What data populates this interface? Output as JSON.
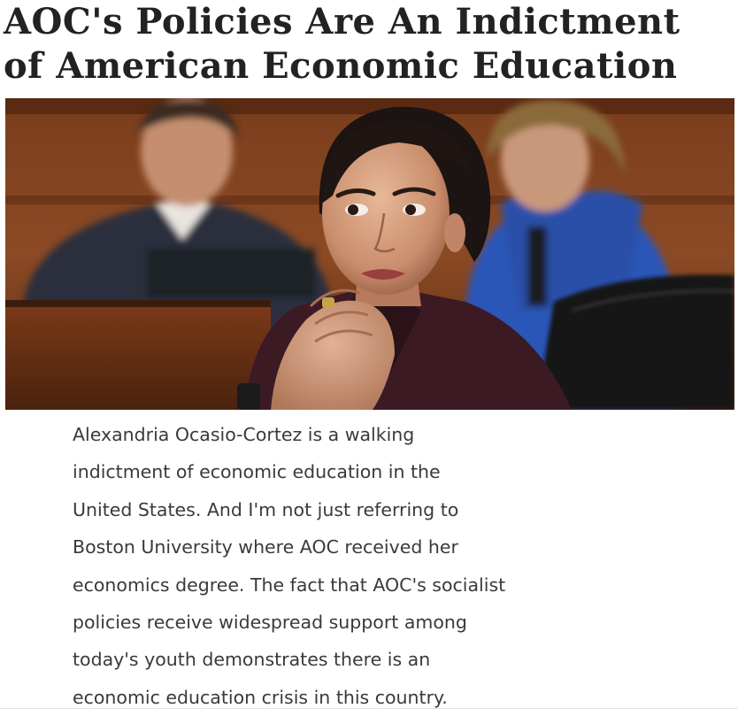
{
  "article": {
    "headline_lines": [
      "AOC's Policies Are An Indictment",
      "of American Economic Education"
    ],
    "body_lines": [
      "Alexandria Ocasio-Cortez is a walking",
      "indictment of economic education in the",
      "United States. And I'm not just referring to",
      "Boston University where AOC received her",
      "economics degree. The fact that AOC's socialist",
      "policies receive widespread support among",
      "today's youth demonstrates there is an",
      "economic education crisis in this country."
    ]
  },
  "colors": {
    "headline": "#222222",
    "body_text": "#3a3a3a",
    "background": "#ffffff"
  }
}
